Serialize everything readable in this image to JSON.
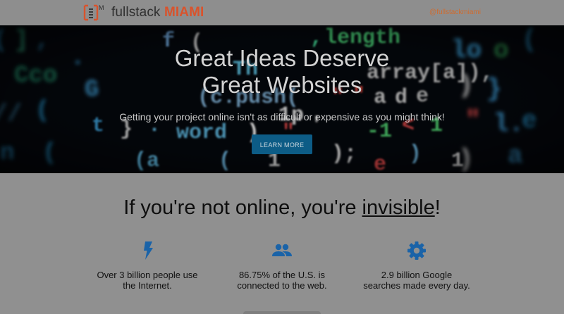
{
  "header": {
    "logo_word": "fullstack",
    "logo_accent": "MIAMI",
    "logo_mark_letter": "M",
    "twitter_handle": "@fullstackmiami"
  },
  "hero": {
    "title_line1": "Great Ideas Deserve",
    "title_line2": "Great Websites",
    "subtitle": "Getting your project online isn't as difficult or expensive as you might think!",
    "button_label": "LEARN MORE"
  },
  "content": {
    "tagline_pre": "If you're not online, you're ",
    "tagline_emphasis": "invisible",
    "tagline_post": "!",
    "features": [
      {
        "icon": "lightning-bolt-icon",
        "line1": "Over 3 billion people use",
        "line2": "the Internet."
      },
      {
        "icon": "people-group-icon",
        "line1": "86.75% of the U.S. is",
        "line2": "connected to the web."
      },
      {
        "icon": "gear-icon",
        "line1": "2.9 billion Google",
        "line2": "searches made every day."
      }
    ]
  },
  "colors": {
    "accent_orange": "#d9532c",
    "button_blue": "#0d5c86",
    "icon_blue": "#1a63a8",
    "overlay_gray": "#8f8f8f"
  }
}
